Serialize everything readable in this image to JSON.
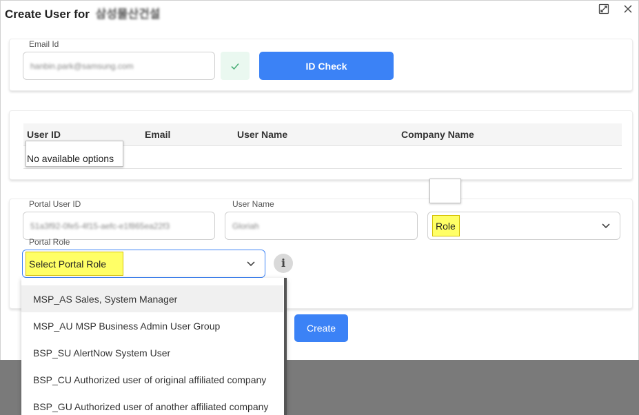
{
  "dialog": {
    "title": "Create User for",
    "company": "삼성물산건설",
    "expand_icon": "expand-icon",
    "close_icon": "close-icon"
  },
  "email_section": {
    "label": "Email Id",
    "value": "hanbin.park@samsung.com",
    "check_icon": "checkmark-icon",
    "id_check_label": "ID Check"
  },
  "table": {
    "columns": [
      "User ID",
      "Email",
      "User Name",
      "Company Name"
    ],
    "empty_text": "No available options"
  },
  "portal": {
    "user_id_label": "Portal User ID",
    "user_id_value": "51a3f92-0fe5-4f15-aefc-e1f865ea22f3",
    "user_name_label": "User Name",
    "user_name_value": "Gloriah",
    "role_placeholder": "Role",
    "portal_role_label": "Portal Role",
    "portal_role_placeholder": "Select Portal Role",
    "info_icon": "i",
    "create_label": "Create"
  },
  "portal_role_options": [
    "MSP_AS Sales, System Manager",
    "MSP_AU MSP Business Admin User Group",
    "BSP_SU AlertNow System User",
    "BSP_CU Authorized user of original affiliated company",
    "BSP_GU Authorized user of another affiliated company"
  ],
  "colors": {
    "primary": "#3b82f6",
    "highlight": "#ffff66",
    "check": "#4caf78",
    "backdrop": "#7a7a7a"
  }
}
